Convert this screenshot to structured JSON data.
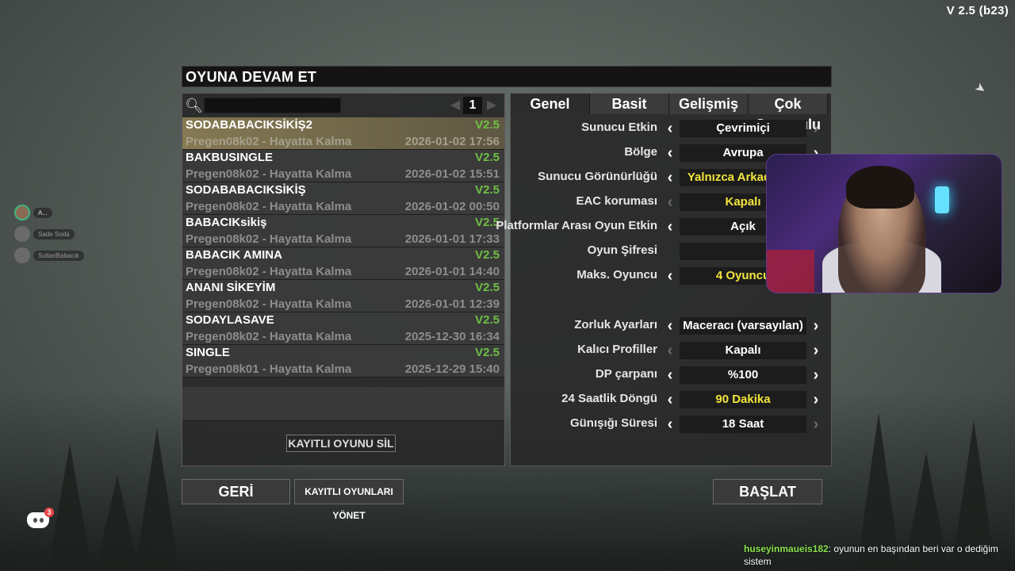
{
  "version": "V 2.5 (b23)",
  "panel_title": "OYUNA DEVAM ET",
  "search": {
    "value": "",
    "placeholder": "",
    "page": "1"
  },
  "saves": [
    {
      "name": "SODABABACIKSİKİŞ2",
      "version": "V2.5",
      "subtitle": "Pregen08k02 - Hayatta Kalma",
      "date": "2026-01-02 17:56",
      "selected": true
    },
    {
      "name": "BAKBUSINGLE",
      "version": "V2.5",
      "subtitle": "Pregen08k02 - Hayatta Kalma",
      "date": "2026-01-02 15:51"
    },
    {
      "name": "SODABABACIKSİKİŞ",
      "version": "V2.5",
      "subtitle": "Pregen08k02 - Hayatta Kalma",
      "date": "2026-01-02 00:50"
    },
    {
      "name": "BABACIKsikiş",
      "version": "V2.5",
      "subtitle": "Pregen08k02 - Hayatta Kalma",
      "date": "2026-01-01 17:33"
    },
    {
      "name": "BABACIK AMINA",
      "version": "V2.5",
      "subtitle": "Pregen08k02 - Hayatta Kalma",
      "date": "2026-01-01 14:40"
    },
    {
      "name": "ANANI SİKEYİM",
      "version": "V2.5",
      "subtitle": "Pregen08k02 - Hayatta Kalma",
      "date": "2026-01-01 12:39"
    },
    {
      "name": "SODAYLASAVE",
      "version": "V2.5",
      "subtitle": "Pregen08k02 - Hayatta Kalma",
      "date": "2025-12-30 16:34"
    },
    {
      "name": "SINGLE",
      "version": "V2.5",
      "subtitle": "Pregen08k01 - Hayatta Kalma",
      "date": "2025-12-29 15:40"
    }
  ],
  "delete_button": "KAYITLI OYUNU SİL",
  "tabs": [
    "Genel",
    "Basit",
    "Gelişmiş",
    "Çok Oyunculu"
  ],
  "settings": [
    {
      "label": "Sunucu Etkin",
      "value": "Çevrimiçi",
      "yellow": false,
      "left_dim": false,
      "right_dim": true
    },
    {
      "label": "Bölge",
      "value": "Avrupa",
      "yellow": false,
      "left_dim": false,
      "right_dim": false
    },
    {
      "label": "Sunucu Görünürlüğü",
      "value": "Yalnızca Arkadaşlar",
      "yellow": true,
      "left_dim": false,
      "right_dim": false
    },
    {
      "label": "EAC koruması",
      "value": "Kapalı",
      "yellow": true,
      "left_dim": true,
      "right_dim": false
    },
    {
      "label": "Platformlar Arası Oyun Etkin",
      "value": "Açık",
      "yellow": false,
      "left_dim": false,
      "right_dim": false
    },
    {
      "label": "Oyun Şifresi",
      "value": "",
      "yellow": false,
      "no_arrows": true
    },
    {
      "label": "Maks. Oyuncu",
      "value": "4 Oyuncu",
      "yellow": true,
      "left_dim": false,
      "right_dim": false
    },
    {
      "label": "Zorluk Ayarları",
      "value": "Maceracı (varsayılan)",
      "yellow": false,
      "left_dim": false,
      "right_dim": false
    },
    {
      "label": "Kalıcı Profiller",
      "value": "Kapalı",
      "yellow": false,
      "left_dim": true,
      "right_dim": false
    },
    {
      "label": "DP çarpanı",
      "value": "%100",
      "yellow": false,
      "left_dim": false,
      "right_dim": false
    },
    {
      "label": "24 Saatlik Döngü",
      "value": "90 Dakika",
      "yellow": true,
      "left_dim": false,
      "right_dim": false
    },
    {
      "label": "Günışığı Süresi",
      "value": "18 Saat",
      "yellow": false,
      "left_dim": false,
      "right_dim": true
    }
  ],
  "buttons": {
    "back": "GERİ",
    "manage": "KAYITLI OYUNLARI YÖNET",
    "start": "BAŞLAT"
  },
  "voice_users": [
    {
      "name": "A...",
      "active": true
    },
    {
      "name": "Sade Soda",
      "active": false
    },
    {
      "name": "SultanBabacık",
      "active": false
    }
  ],
  "discord_badge": "3",
  "chat": {
    "user": "huseyinmaueis182",
    "message": "oyunun en başından beri var o dediğim sistem"
  }
}
